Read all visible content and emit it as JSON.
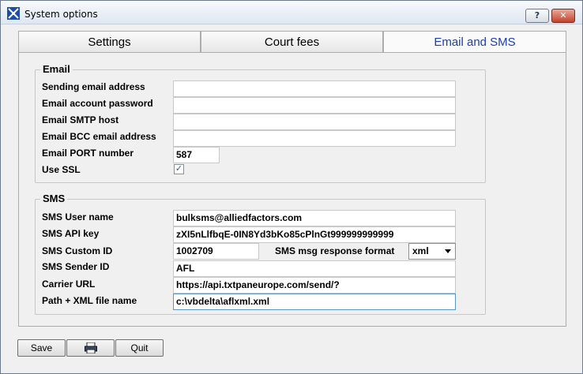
{
  "window": {
    "title": "System options",
    "help_glyph": "?",
    "close_glyph": "✕"
  },
  "tabs": [
    {
      "label": "Settings",
      "active": false
    },
    {
      "label": "Court fees",
      "active": false
    },
    {
      "label": "Email and SMS",
      "active": true
    }
  ],
  "email": {
    "legend": "Email",
    "sending_address": {
      "label": "Sending email address",
      "value": ""
    },
    "password": {
      "label": "Email account password",
      "value": ""
    },
    "smtp_host": {
      "label": "Email SMTP host",
      "value": ""
    },
    "bcc_address": {
      "label": "Email BCC email address",
      "value": ""
    },
    "port": {
      "label": "Email PORT number",
      "value": "587"
    },
    "use_ssl": {
      "label": "Use SSL",
      "checked": true,
      "glyph": "✓"
    }
  },
  "sms": {
    "legend": "SMS",
    "user_name": {
      "label": "SMS User name",
      "value": "bulksms@alliedfactors.com"
    },
    "api_key": {
      "label": "SMS API key",
      "value": "zXI5nLlfbqE-0IN8Yd3bKo85cPlnGt999999999999"
    },
    "custom_id": {
      "label": "SMS Custom ID",
      "value": "1002709"
    },
    "response_format": {
      "label": "SMS msg response format",
      "value": "xml"
    },
    "sender_id": {
      "label": "SMS Sender ID",
      "value": "AFL"
    },
    "carrier_url": {
      "label": "Carrier URL",
      "value": "https://api.txtpaneurope.com/send/?"
    },
    "xml_path": {
      "label": "Path + XML file name",
      "value": "c:\\vbdelta\\aflxml.xml"
    }
  },
  "buttons": {
    "save": "Save",
    "print_icon": "printer-icon",
    "quit": "Quit"
  },
  "colors": {
    "active_tab_text": "#1c3eae",
    "close_button": "#c6422c",
    "focus_border": "#5d95c8"
  }
}
